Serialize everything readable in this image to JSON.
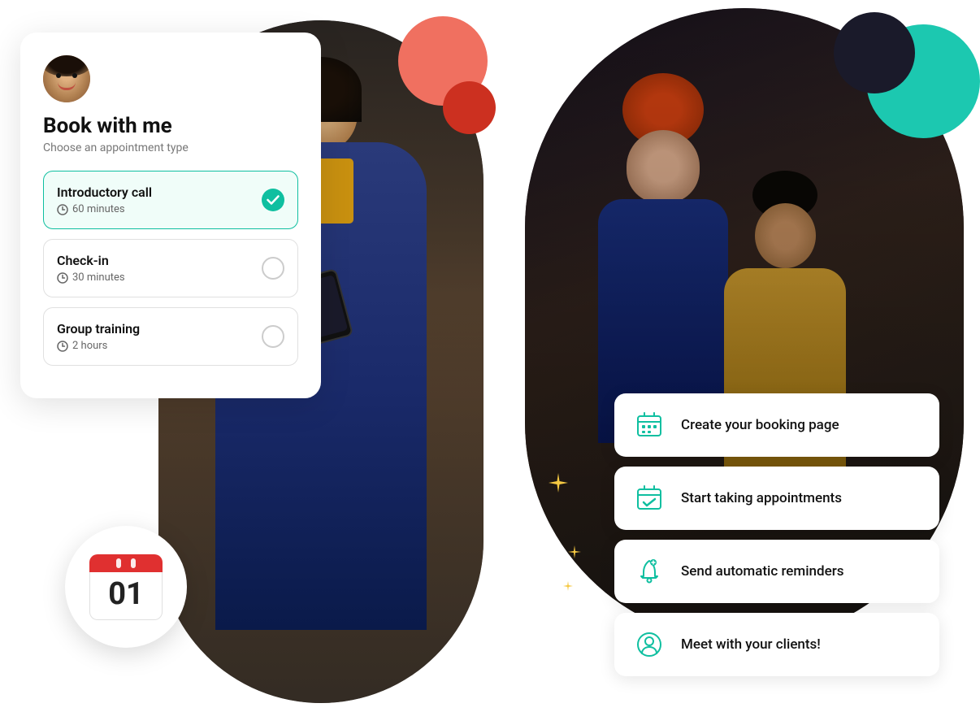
{
  "scene": {
    "background_color": "#ffffff"
  },
  "booking_card": {
    "title": "Book with me",
    "subtitle": "Choose an appointment type",
    "avatar_alt": "Profile photo",
    "appointments": [
      {
        "id": "introductory-call",
        "name": "Introductory call",
        "duration": "60 minutes",
        "selected": true
      },
      {
        "id": "check-in",
        "name": "Check-in",
        "duration": "30 minutes",
        "selected": false
      },
      {
        "id": "group-training",
        "name": "Group training",
        "duration": "2 hours",
        "selected": false
      }
    ]
  },
  "calendar": {
    "date": "01"
  },
  "feature_cards": [
    {
      "id": "create-booking",
      "icon": "calendar-grid",
      "text": "Create your booking page"
    },
    {
      "id": "start-appointments",
      "icon": "calendar-check",
      "text": "Start taking appointments"
    },
    {
      "id": "send-reminders",
      "icon": "bell",
      "text": "Send automatic reminders"
    },
    {
      "id": "meet-clients",
      "icon": "person",
      "text": "Meet with your clients!"
    }
  ],
  "decorations": {
    "coral_circle_color": "#f07060",
    "teal_circle_color": "#1cc8b0",
    "dark_circle_color": "#1a1a2a",
    "sparkle_color": "#f5c842",
    "accent_color": "#0fbfa0"
  }
}
